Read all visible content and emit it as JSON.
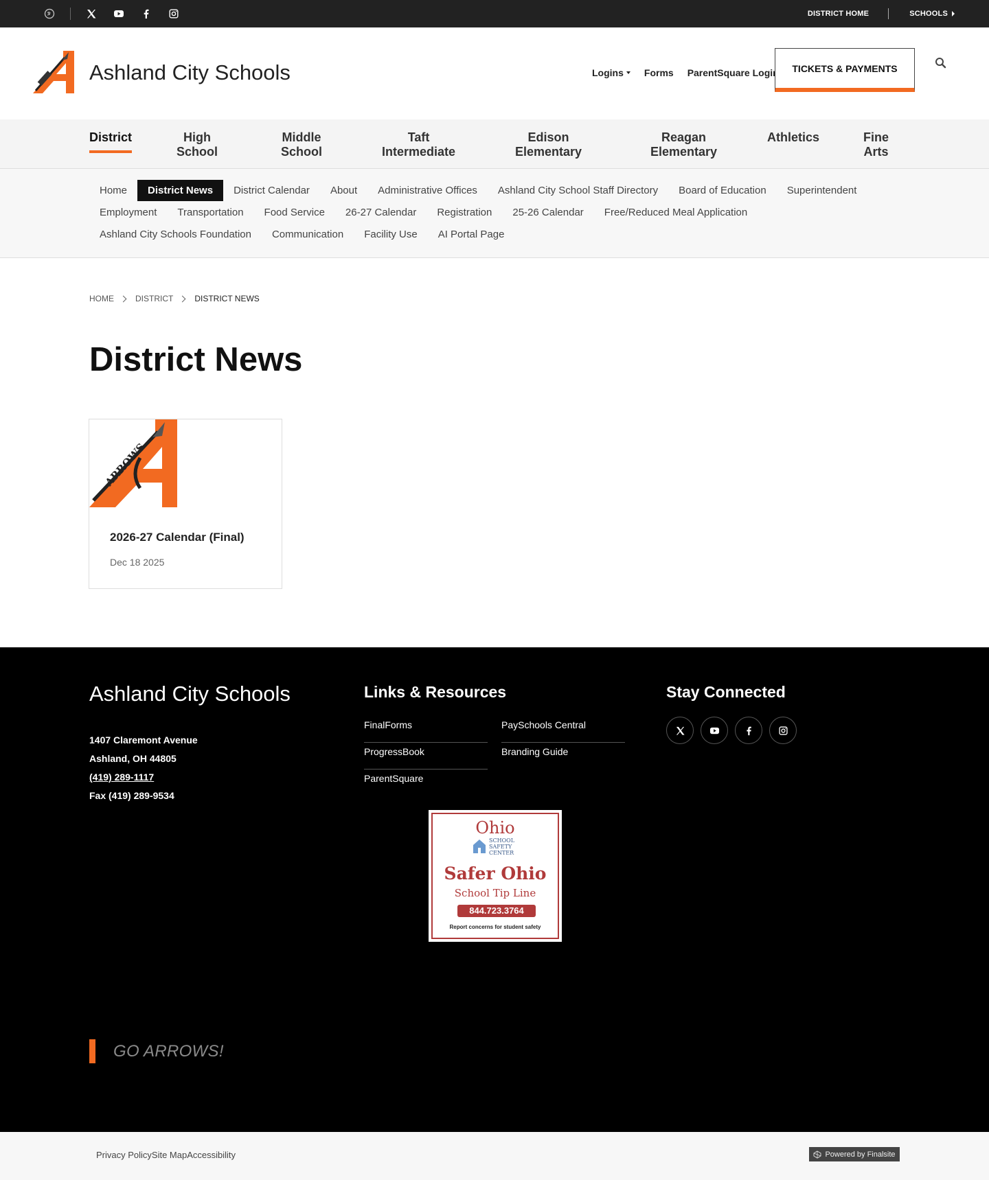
{
  "topbar": {
    "social_icons": [
      "translate-icon",
      "x-icon",
      "youtube-icon",
      "facebook-icon",
      "instagram-icon"
    ],
    "district_home": "DISTRICT HOME",
    "schools": "SCHOOLS"
  },
  "header": {
    "site_title": "Ashland City Schools",
    "links": {
      "logins": "Logins",
      "forms": "Forms",
      "parentsquare": "ParentSquare Login"
    },
    "tickets": "TICKETS & PAYMENTS"
  },
  "main_nav": {
    "items": [
      {
        "line1": "District",
        "line2": ""
      },
      {
        "line1": "High",
        "line2": "School"
      },
      {
        "line1": "Middle",
        "line2": "School"
      },
      {
        "line1": "Taft",
        "line2": "Intermediate"
      },
      {
        "line1": "Edison",
        "line2": "Elementary"
      },
      {
        "line1": "Reagan",
        "line2": "Elementary"
      },
      {
        "line1": "Athletics",
        "line2": ""
      },
      {
        "line1": "Fine",
        "line2": "Arts"
      }
    ],
    "active": "District"
  },
  "sub_nav": {
    "row1": [
      "Home",
      "District News",
      "District Calendar",
      "About",
      "Administrative Offices",
      "Ashland City School Staff Directory",
      "Board of Education",
      "Superintendent"
    ],
    "row2": [
      "Employment",
      "Transportation",
      "Food Service",
      "26-27 Calendar",
      "Registration",
      "25-26 Calendar",
      "Free/Reduced Meal Application"
    ],
    "row3": [
      "Ashland City Schools Foundation",
      "Communication",
      "Facility Use",
      "AI Portal Page"
    ],
    "active": "District News"
  },
  "breadcrumb": [
    "HOME",
    "DISTRICT",
    "DISTRICT NEWS"
  ],
  "page_title": "District News",
  "news": [
    {
      "title": "2026-27 Calendar (Final)",
      "date": "Dec 18 2025",
      "thumb_text": "ARROWS"
    }
  ],
  "footer": {
    "title": "Ashland City Schools",
    "address_line1": "1407 Claremont Avenue",
    "address_line2": "Ashland, OH  44805",
    "phone": "(419) 289-1117",
    "fax": "Fax (419) 289-9534",
    "links_heading": "Links & Resources",
    "links": [
      "FinalForms",
      "PaySchools Central",
      "ProgressBook",
      "Branding Guide",
      "ParentSquare"
    ],
    "safer_ohio": {
      "ohio": "Ohio",
      "center": [
        "SCHOOL",
        "SAFETY",
        "CENTER"
      ],
      "title": "Safer Ohio",
      "subtitle": "School Tip Line",
      "number": "844.723.3764",
      "tagline": "Report concerns for student safety"
    },
    "stay_heading": "Stay Connected",
    "social_icons": [
      "x-icon",
      "youtube-icon",
      "facebook-icon",
      "instagram-icon"
    ],
    "motto": "GO ARROWS!"
  },
  "bottom": {
    "links": [
      "Privacy Policy",
      "Site Map",
      "Accessibility"
    ],
    "powered": "Powered by Finalsite"
  },
  "colors": {
    "accent": "#f26a21",
    "dark": "#222222",
    "footer": "#000000"
  }
}
